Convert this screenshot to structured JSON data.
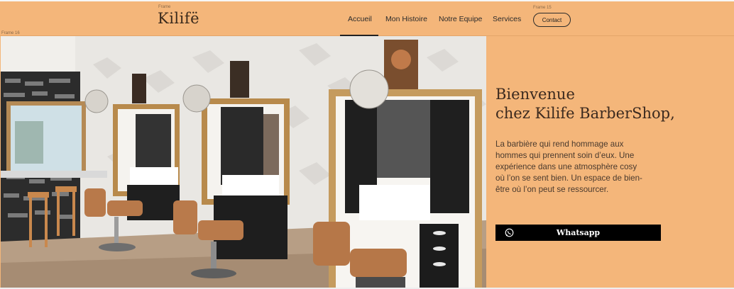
{
  "header": {
    "logo_frame_label": "Frame",
    "logo_text": "Kilifë",
    "nav": [
      "Accueil",
      "Mon Histoire",
      "Notre Equipe",
      "Services"
    ],
    "contact_frame_label": "Frame 15",
    "contact_label": "Contact",
    "background": "#f4b67a"
  },
  "hero": {
    "frame_label": "Frame 16",
    "title_line1": "Bienvenue",
    "title_line2": "chez Kilife BarberShop,",
    "paragraph": "La barbière qui rend hommage aux hommes qui prennent soin d’eux. Une expérience dans une atmosphère cosy où l’on se sent bien. Un espace de bien-être où l’on peut se ressourcer.",
    "whatsapp_label": "Whatsapp",
    "whatsapp_icon": "whatsapp-icon",
    "photo_alt": "barbershop-salon-photo"
  }
}
